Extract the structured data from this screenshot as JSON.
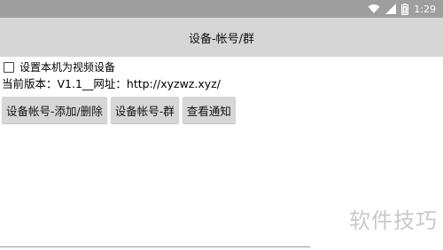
{
  "status_bar": {
    "time": "1:29",
    "icons": [
      "wifi-icon",
      "signal-icon",
      "battery-icon"
    ]
  },
  "title_bar": {
    "title": "设备-帐号/群"
  },
  "main": {
    "checkbox_label": "设置本机为视频设备",
    "checkbox_checked": false,
    "info_text": "当前版本：V1.1__网址：http://xyzwz.xyz/",
    "buttons": [
      {
        "label": "设备帐号-添加/删除"
      },
      {
        "label": "设备帐号-群"
      },
      {
        "label": "查看通知"
      }
    ]
  },
  "watermark": {
    "text": "软件技巧"
  },
  "colors": {
    "status_bar_bg": "#9e9e9e",
    "title_bar_bg": "#d6d6d6",
    "button_bg": "#d6d6d6"
  }
}
